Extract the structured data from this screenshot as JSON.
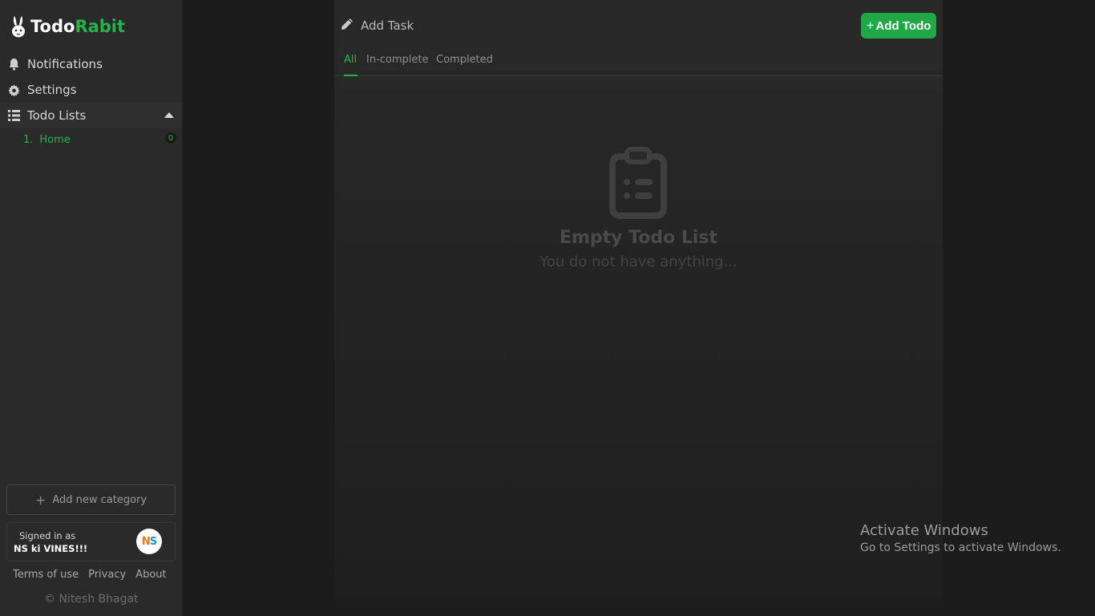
{
  "brand": {
    "part1": "Todo",
    "part2": "Rabit"
  },
  "sidebar": {
    "notifications_label": "Notifications",
    "settings_label": "Settings",
    "todo_lists_label": "Todo Lists",
    "lists": [
      {
        "number": "1.",
        "name": "Home",
        "count": "0"
      }
    ],
    "add_category_label": "Add new category",
    "signed_in_label": "Signed in as",
    "user_name": "NS ki VINES!!!",
    "avatar_text_n": "N",
    "avatar_text_s": "S",
    "footer_links": [
      "Terms of use",
      "Privacy",
      "About"
    ],
    "copyright": "© Nitesh Bhagat"
  },
  "main": {
    "add_task_label": "Add Task",
    "add_todo_label": "Add Todo",
    "tabs": [
      "All",
      "In-complete",
      "Completed"
    ],
    "active_tab": "All",
    "empty_title": "Empty Todo List",
    "empty_subtitle": "You do not have anything..."
  },
  "watermark": {
    "title": "Activate Windows",
    "subtitle": "Go to Settings to activate Windows."
  },
  "colors": {
    "accent": "#27b24a",
    "button": "#1fa845",
    "sidebar_bg": "#2a2a2a",
    "main_bg": "#292929",
    "page_bg": "#1c1c1c"
  },
  "icons": {
    "logo": "rabbit-icon",
    "notifications": "bell-icon",
    "settings": "gear-icon",
    "todo_lists": "list-icon",
    "collapse": "caret-up-icon",
    "add_task": "pencil-icon",
    "add_todo": "plus-icon",
    "empty": "clipboard-list-icon"
  }
}
